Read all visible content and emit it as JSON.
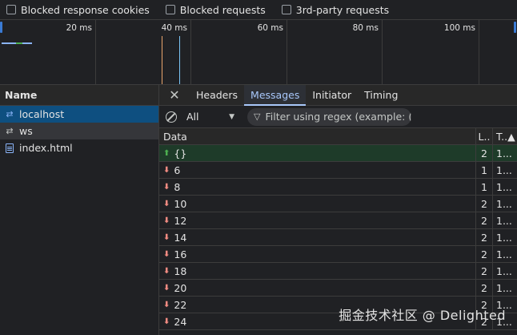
{
  "filters": [
    {
      "label": "Blocked response cookies"
    },
    {
      "label": "Blocked requests"
    },
    {
      "label": "3rd-party requests"
    }
  ],
  "timeline": {
    "ticks": [
      "20 ms",
      "40 ms",
      "60 ms",
      "80 ms",
      "100 ms"
    ]
  },
  "requests_panel": {
    "header": "Name",
    "items": [
      {
        "name": "localhost",
        "icon": "websocket-icon"
      },
      {
        "name": "ws",
        "icon": "websocket-icon"
      },
      {
        "name": "index.html",
        "icon": "document-icon"
      }
    ]
  },
  "detail_tabs": {
    "close_glyph": "✕",
    "tabs": [
      "Headers",
      "Messages",
      "Initiator",
      "Timing"
    ],
    "active": "Messages"
  },
  "messages_filter": {
    "select_value": "All",
    "search_placeholder": "Filter using regex (example: (we"
  },
  "messages_table": {
    "columns": {
      "data": "Data",
      "length": "L..",
      "time": "T..▲"
    },
    "rows": [
      {
        "direction": "sent",
        "data": "{}",
        "length": "2",
        "time": "1..."
      },
      {
        "direction": "received",
        "data": "6",
        "length": "1",
        "time": "1..."
      },
      {
        "direction": "received",
        "data": "8",
        "length": "1",
        "time": "1..."
      },
      {
        "direction": "received",
        "data": "10",
        "length": "2",
        "time": "1..."
      },
      {
        "direction": "received",
        "data": "12",
        "length": "2",
        "time": "1..."
      },
      {
        "direction": "received",
        "data": "14",
        "length": "2",
        "time": "1..."
      },
      {
        "direction": "received",
        "data": "16",
        "length": "2",
        "time": "1..."
      },
      {
        "direction": "received",
        "data": "18",
        "length": "2",
        "time": "1..."
      },
      {
        "direction": "received",
        "data": "20",
        "length": "2",
        "time": "1..."
      },
      {
        "direction": "received",
        "data": "22",
        "length": "2",
        "time": "1..."
      },
      {
        "direction": "received",
        "data": "24",
        "length": "2",
        "time": "1..."
      }
    ]
  },
  "watermark": "掘金技术社区 @ Delighted",
  "colors": {
    "accent": "#a8c7fa",
    "selected_row": "#0e4f80",
    "sent_row": "#1e3b29",
    "sent_arrow": "#4caf50",
    "received_arrow": "#f28b82"
  }
}
